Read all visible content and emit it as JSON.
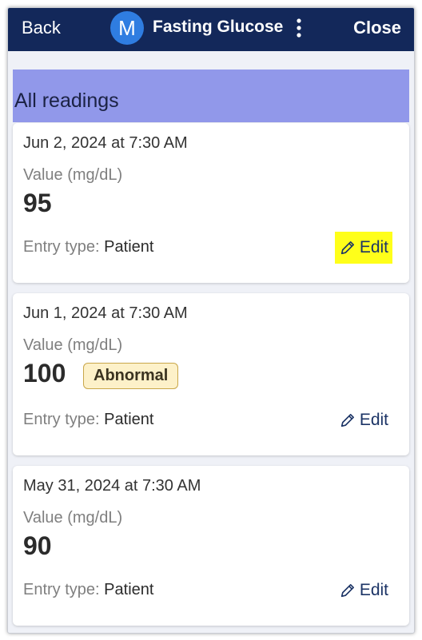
{
  "header": {
    "back_label": "Back",
    "avatar_letter": "M",
    "title": "Fasting Glucose",
    "close_label": "Close",
    "colors": {
      "background": "#13285a",
      "avatar": "#2f7de1"
    }
  },
  "section": {
    "title": "All readings",
    "color": "#9198ea"
  },
  "labels": {
    "value_label": "Value (mg/dL)",
    "entry_type_label": "Entry type:",
    "edit_label": "Edit"
  },
  "readings": [
    {
      "date": "Jun 2, 2024 at 7:30 AM",
      "value": "95",
      "entry_type": "Patient",
      "badge": "",
      "edit_highlighted": true
    },
    {
      "date": "Jun 1, 2024 at 7:30 AM",
      "value": "100",
      "entry_type": "Patient",
      "badge": "Abnormal",
      "edit_highlighted": false
    },
    {
      "date": "May 31, 2024 at 7:30 AM",
      "value": "90",
      "entry_type": "Patient",
      "badge": "",
      "edit_highlighted": false
    }
  ],
  "icons": {
    "menu": "kebab-menu-icon",
    "edit": "pencil-icon"
  },
  "highlight_color": "#ffff1a"
}
